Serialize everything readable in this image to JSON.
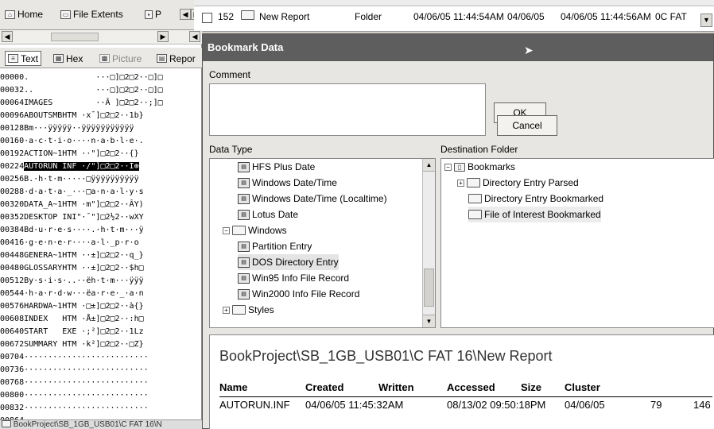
{
  "top_tabs": {
    "home": "Home",
    "file_extents": "File Extents",
    "permissions": "P"
  },
  "top_row": {
    "item_id": "152",
    "name": "New Report",
    "type": "Folder",
    "created": "04/06/05 11:44:54AM",
    "accessed": "04/06/05",
    "written": "04/06/05 11:44:56AM",
    "extra": "0C FAT"
  },
  "view_tabs": {
    "text": "Text",
    "hex": "Hex",
    "picture": "Picture",
    "report": "Repor"
  },
  "hex_lines": [
    {
      "off": "00000",
      "data": ".              ···□]□2□2··□]□"
    },
    {
      "off": "00032",
      "data": "..             ···□]□2□2··□]□"
    },
    {
      "off": "00064",
      "data": "IMAGES         ··Â ]□2□2··;]□"
    },
    {
      "off": "00096",
      "data": "ABOUTSMBHTM ·x¯]□2□2··1b}"
    },
    {
      "off": "00128",
      "data": "Bm···ÿÿÿÿÿ··ÿÿÿÿÿÿÿÿÿÿÿ"
    },
    {
      "off": "00160",
      "data": "·a·c·t·i·o····n·a·b·l·e·."
    },
    {
      "off": "00192",
      "data": "ACTION~1HTM ··\"]□2□2··{}"
    },
    {
      "off": "00224",
      "data": "AUTORUN INF ·/\"]□2□2··I⊕"
    },
    {
      "off": "00256",
      "data": "B.·h·t·m·····□ÿÿÿÿÿÿÿÿÿÿ"
    },
    {
      "off": "00288",
      "data": "·d·a·t·a·_···□a·n·a·l·y·s"
    },
    {
      "off": "00320",
      "data": "DATA_A~1HTM ·m\"]□2□2··ÂY)"
    },
    {
      "off": "00352",
      "data": "DESKTOP INI\"·¯\"]□2½2··wXY"
    },
    {
      "off": "00384",
      "data": "Bd·u·r·e·s····.·h·t·m···ÿ"
    },
    {
      "off": "00416",
      "data": "·g·e·n·e·r····a·l·_p·r·o"
    },
    {
      "off": "00448",
      "data": "GENERA~1HTM ··±]□2□2··q_}"
    },
    {
      "off": "00480",
      "data": "GLOSSARYHTM ··±]□2□2··$h□"
    },
    {
      "off": "00512",
      "data": "By·s·i·s·..··ëh·t·m···ÿÿÿ"
    },
    {
      "off": "00544",
      "data": "·h·a·r·d·w···ëa·r·e·_·a·n"
    },
    {
      "off": "00576",
      "data": "HARDWA~1HTM ·□±]□2□2··à{}"
    },
    {
      "off": "00608",
      "data": "INDEX   HTM ·Å±]□2□2··:h□"
    },
    {
      "off": "00640",
      "data": "START   EXE ·;²]□2□2··1Lz"
    },
    {
      "off": "00672",
      "data": "SUMMARY HTM ·k²]□2□2··□Z}"
    },
    {
      "off": "00704",
      "data": "··························"
    },
    {
      "off": "00736",
      "data": "··························"
    },
    {
      "off": "00768",
      "data": "··························"
    },
    {
      "off": "00800",
      "data": "··························"
    },
    {
      "off": "00832",
      "data": "··························"
    },
    {
      "off": "00864",
      "data": "··························"
    }
  ],
  "status_path": "BookProject\\SB_1GB_USB01\\C FAT 16\\N",
  "dialog": {
    "title": "Bookmark Data",
    "comment_label": "Comment",
    "ok": "OK",
    "cancel": "Cancel",
    "data_type_label": "Data Type",
    "destination_label": "Destination Folder",
    "data_types": [
      "HFS Plus Date",
      "Windows Date/Time",
      "Windows Date/Time (Localtime)",
      "Lotus Date",
      "Windows",
      "Partition Entry",
      "DOS Directory Entry",
      "Win95 Info File Record",
      "Win2000 Info File Record",
      "Styles"
    ],
    "destinations": [
      "Bookmarks",
      "Directory Entry Parsed",
      "Directory Entry Bookmarked",
      "File of Interest Bookmarked"
    ]
  },
  "preview": {
    "path": "BookProject\\SB_1GB_USB01\\C FAT 16\\New Report",
    "headers": [
      "Name",
      "Created",
      "Written",
      "Accessed",
      "Size",
      "Cluster"
    ],
    "row": [
      "AUTORUN.INF",
      "04/06/05 11:45:32AM",
      "08/13/02 09:50:18PM",
      "04/06/05",
      "79",
      "146"
    ]
  }
}
